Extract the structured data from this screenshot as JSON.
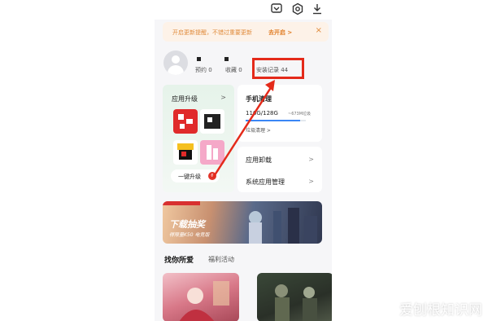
{
  "notice": {
    "text": "开启更新提醒，不错过重要更新",
    "action": "去开启 >",
    "close": "×"
  },
  "profile": {
    "reservations": "预约 0",
    "favorites": "收藏 0",
    "install_records": "安装记录 44"
  },
  "upgrade_card": {
    "title": "应用升级",
    "chevron": ">",
    "button_label": "一键升级",
    "badge_count": "6"
  },
  "clean_card": {
    "title": "手机清理",
    "storage": "116G/128G",
    "free": "~673M垃圾",
    "used_fraction": 0.9,
    "link": "垃圾清理 >"
  },
  "menu": [
    {
      "label": "应用卸载",
      "chevron": ">"
    },
    {
      "label": "系统应用管理",
      "chevron": ">"
    }
  ],
  "banner": {
    "title": "下载抽奖",
    "subtitle": "得限量K50 电竞版"
  },
  "tabs": {
    "active": "找你所爱",
    "inactive": "福利活动"
  },
  "watermark": "爱刨根知识网",
  "colors": {
    "accent": "#e07a20",
    "annotation": "#e42a1a",
    "progress": "#3a86f5"
  }
}
